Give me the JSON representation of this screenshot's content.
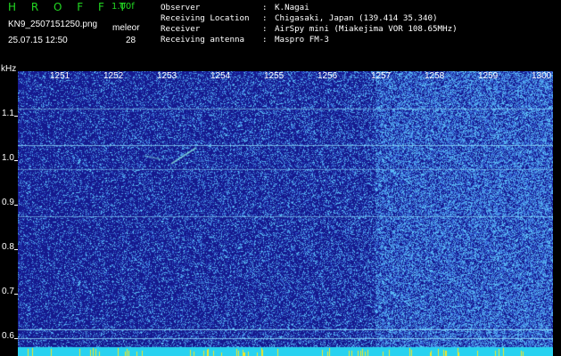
{
  "header": {
    "app_title": "H R O F F T",
    "version": "1.00f",
    "filename": "KN9_2507151250.png",
    "meteor_label": "meleor",
    "timestamp": "25.07.15 12:50",
    "meteor_count": "28"
  },
  "info": [
    {
      "label": "Observer",
      "value": "K.Nagai"
    },
    {
      "label": "Receiving Location",
      "value": "Chigasaki, Japan (139.414 35.340)"
    },
    {
      "label": "Receiver",
      "value": "AirSpy mini (Miakejima VOR 108.65MHz)"
    },
    {
      "label": "Receiving antenna",
      "value": "Maspro FM-3"
    }
  ],
  "axis": {
    "y_unit": "kHz",
    "y_ticks": [
      "1.1",
      "1.0",
      "0.9",
      "0.8",
      "0.7",
      "0.6"
    ],
    "x_ticks": [
      "1251",
      "1252",
      "1253",
      "1254",
      "1255",
      "1256",
      "1257",
      "1258",
      "1259",
      "1300"
    ]
  },
  "colors": {
    "background": "#000000",
    "spectrogram_base": "#15198e",
    "title_green": "#22d822",
    "baseline_cyan": "#28d2f0",
    "marker_yellow": "#f0e628"
  }
}
